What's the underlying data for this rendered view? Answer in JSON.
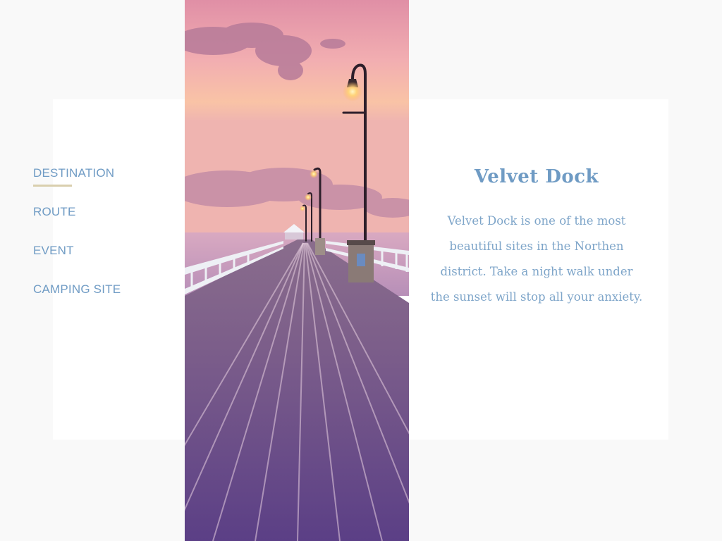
{
  "nav": {
    "items": [
      {
        "label": "DESTINATION",
        "active": true
      },
      {
        "label": "ROUTE",
        "active": false
      },
      {
        "label": "EVENT",
        "active": false
      },
      {
        "label": "CAMPING SITE",
        "active": false
      }
    ]
  },
  "destination": {
    "title": "Velvet Dock",
    "description": "Velvet Dock is one of the most beautiful sites in the Northen district. Take a night walk under the sunset will stop all your anxiety."
  },
  "colors": {
    "accent_text": "#6f9bc4",
    "underline": "#d9cfae",
    "page_background": "#f9f9f9",
    "card_background": "#ffffff"
  }
}
